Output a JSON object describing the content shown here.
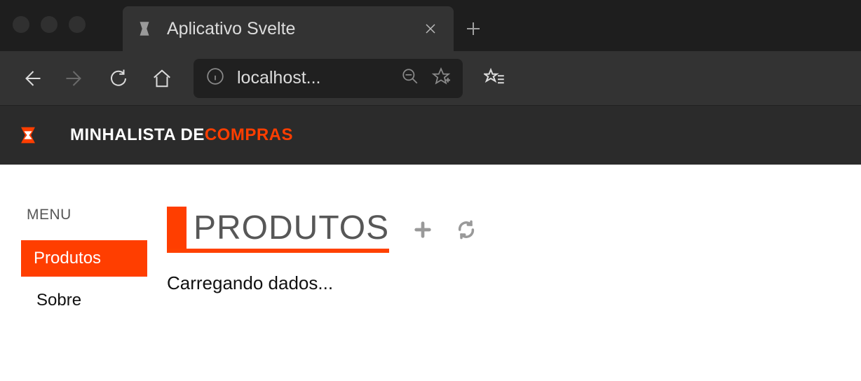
{
  "browser": {
    "tab_title": "Aplicativo Svelte",
    "url_display": "localhost..."
  },
  "app_header": {
    "title_part1": "MINHA",
    "title_part2": "LISTA DE",
    "title_part3": "COMPRAS"
  },
  "sidebar": {
    "menu_label": "MENU",
    "items": [
      {
        "label": "Produtos",
        "active": true
      },
      {
        "label": "Sobre",
        "active": false
      }
    ]
  },
  "main": {
    "page_title": "PRODUTOS",
    "loading_text": "Carregando dados..."
  }
}
